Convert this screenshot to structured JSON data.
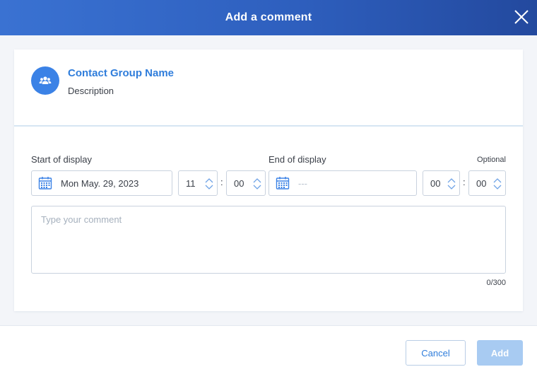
{
  "dialog": {
    "title": "Add a comment",
    "close_icon": "close-icon"
  },
  "group": {
    "name": "Contact Group Name",
    "description": "Description",
    "icon": "contact-group-icon"
  },
  "start": {
    "label": "Start of display",
    "date": "Mon May. 29, 2023",
    "hour": "11",
    "minute": "00"
  },
  "end": {
    "label": "End of display",
    "optional": "Optional",
    "date_placeholder": "---",
    "hour": "00",
    "minute": "00"
  },
  "time_separator": ":",
  "comment": {
    "placeholder": "Type your comment",
    "counter": "0/300"
  },
  "footer": {
    "cancel_label": "Cancel",
    "add_label": "Add"
  },
  "colors": {
    "header_start": "#3a72d2",
    "header_end": "#23499e",
    "accent": "#2f7ddb",
    "add_disabled": "#a8cbf2"
  }
}
